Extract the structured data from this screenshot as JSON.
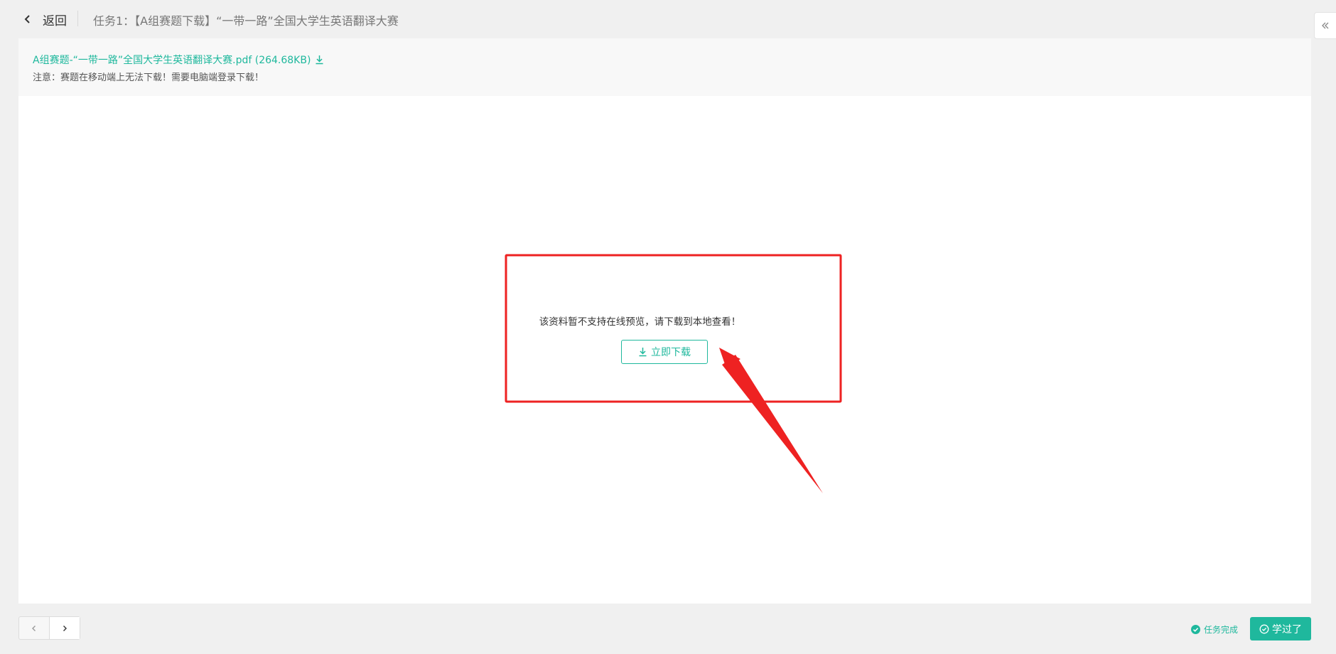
{
  "header": {
    "back_label": "返回",
    "title": "任务1：【A组赛题下载】“一带一路”全国大学生英语翻译大赛"
  },
  "file": {
    "link_label": "A组赛题-“一带一路”全国大学生英语翻译大赛.pdf (264.68KB)",
    "note": "注意：赛题在移动端上无法下载！需要电脑端登录下载！"
  },
  "preview": {
    "message": "该资料暂不支持在线预览，请下载到本地查看！",
    "download_label": "立即下载"
  },
  "footer": {
    "status_label": "任务完成",
    "learned_label": "学过了"
  },
  "colors": {
    "accent": "#1fb89d",
    "annotation": "#ee2222"
  },
  "icons": {
    "back": "chevron-left-icon",
    "collapse": "double-chevron-left-icon",
    "download": "download-icon",
    "prev": "chevron-left-icon",
    "next": "chevron-right-icon",
    "status": "check-circle-icon",
    "learned": "check-circle-outline-icon"
  }
}
